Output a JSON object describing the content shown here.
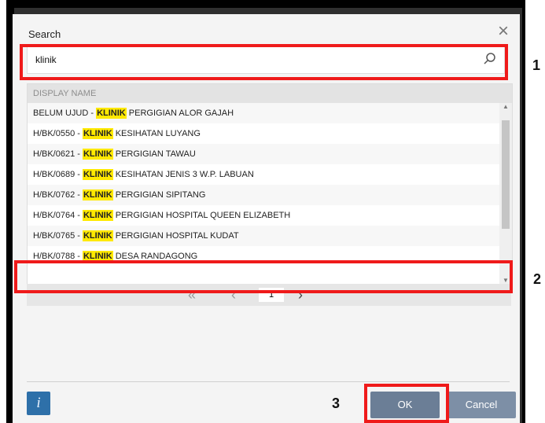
{
  "dialog": {
    "title": "Search",
    "search_value": "klinik",
    "header": "DISPLAY NAME",
    "page": "1",
    "ok": "OK",
    "cancel": "Cancel",
    "info": "i"
  },
  "rows": [
    {
      "prefix": "BELUM UJUD - ",
      "hit": "KLINIK",
      "suffix": " PERGIGIAN ALOR GAJAH"
    },
    {
      "prefix": "H/BK/0550 - ",
      "hit": "KLINIK",
      "suffix": " KESIHATAN LUYANG"
    },
    {
      "prefix": "H/BK/0621 - ",
      "hit": "KLINIK",
      "suffix": " PERGIGIAN TAWAU"
    },
    {
      "prefix": "H/BK/0689 - ",
      "hit": "KLINIK",
      "suffix": " KESIHATAN JENIS 3 W.P. LABUAN"
    },
    {
      "prefix": "H/BK/0762 - ",
      "hit": "KLINIK",
      "suffix": " PERGIGIAN SIPITANG"
    },
    {
      "prefix": "H/BK/0764 - ",
      "hit": "KLINIK",
      "suffix": " PERGIGIAN HOSPITAL QUEEN ELIZABETH"
    },
    {
      "prefix": "H/BK/0765 - ",
      "hit": "KLINIK",
      "suffix": " PERGIGIAN HOSPITAL KUDAT"
    },
    {
      "prefix": "H/BK/0788 - ",
      "hit": "KLINIK",
      "suffix": " DESA RANDAGONG"
    }
  ],
  "callouts": [
    "1",
    "2",
    "3"
  ]
}
